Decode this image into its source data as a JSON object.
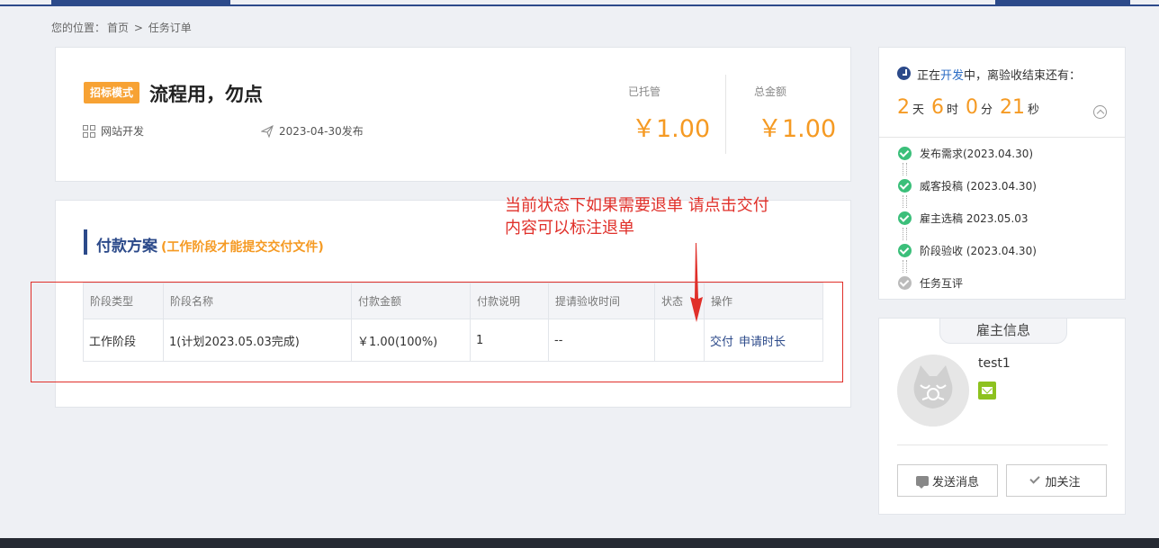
{
  "breadcrumb": {
    "prefix": "您的位置：",
    "home": "首页",
    "sep": ">",
    "current": "任务订单"
  },
  "order": {
    "mode_badge": "招标模式",
    "title": "流程用，勿点",
    "category": "网站开发",
    "published": "2023-04-30发布",
    "escrow_label": "已托管",
    "escrow_amount": "￥1.00",
    "total_label": "总金额",
    "total_amount": "￥1.00"
  },
  "payment": {
    "title": "付款方案",
    "subtitle": "(工作阶段才能提交交付文件)",
    "headers": [
      "阶段类型",
      "阶段名称",
      "付款金额",
      "付款说明",
      "提请验收时间",
      "状态",
      "操作"
    ],
    "rows": [
      {
        "type": "工作阶段",
        "name": "1(计划2023.05.03完成)",
        "amount": "￥1.00(100%)",
        "note": "1",
        "submit_time": "--",
        "status": "",
        "action_deliver": "交付",
        "action_extend": "申请时长"
      }
    ]
  },
  "annotation": {
    "line1": "当前状态下如果需要退单 请点击交付",
    "line2": "内容可以标注退单"
  },
  "status": {
    "prefix": "正在",
    "stage": "开发",
    "suffix": "中，离验收结束还有：",
    "countdown": {
      "days": "2",
      "days_unit": "天",
      "hours": "6",
      "hours_unit": "时",
      "minutes": "0",
      "minutes_unit": "分",
      "seconds": "21",
      "seconds_unit": "秒"
    },
    "steps": [
      {
        "label": "发布需求(2023.04.30)",
        "done": true
      },
      {
        "label": "威客投稿 (2023.04.30)",
        "done": true
      },
      {
        "label": "雇主选稿 2023.05.03",
        "done": true
      },
      {
        "label": "阶段验收 (2023.04.30)",
        "done": true
      },
      {
        "label": "任务互评",
        "done": false
      }
    ]
  },
  "employer": {
    "tab": "雇主信息",
    "username": "test1",
    "send_message": "发送消息",
    "follow": "加关注"
  },
  "colors": {
    "brand": "#2c4a8a",
    "accent": "#f59a23",
    "annotation": "#e0302a",
    "success": "#3bbf7a"
  }
}
